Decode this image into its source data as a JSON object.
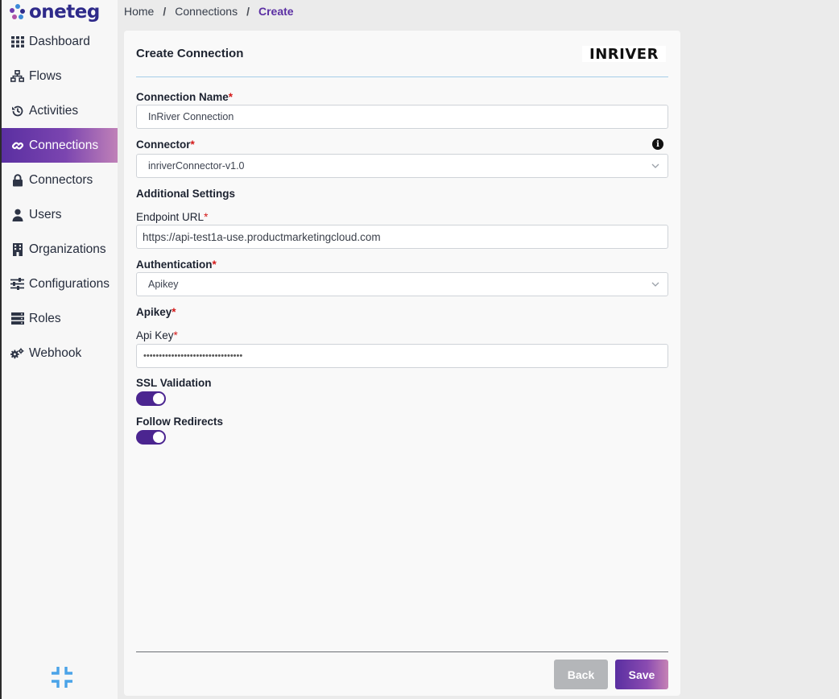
{
  "app": {
    "logo_text": "oneteg"
  },
  "breadcrumb": [
    "Home",
    "Connections",
    "Create"
  ],
  "sidebar": {
    "items": [
      {
        "label": "Dashboard",
        "icon": "grid-icon"
      },
      {
        "label": "Flows",
        "icon": "sitemap-icon"
      },
      {
        "label": "Activities",
        "icon": "history-icon"
      },
      {
        "label": "Connections",
        "icon": "link-icon",
        "active": true
      },
      {
        "label": "Connectors",
        "icon": "lock-icon"
      },
      {
        "label": "Users",
        "icon": "user-icon"
      },
      {
        "label": "Organizations",
        "icon": "building-icon"
      },
      {
        "label": "Configurations",
        "icon": "sliders-icon"
      },
      {
        "label": "Roles",
        "icon": "server-icon"
      },
      {
        "label": "Webhook",
        "icon": "gears-icon"
      }
    ]
  },
  "form": {
    "title": "Create Connection",
    "brand_logo": "INRIVER",
    "connection_name": {
      "label": "Connection Name",
      "value": "InRiver Connection"
    },
    "connector": {
      "label": "Connector",
      "value": "inriverConnector-v1.0"
    },
    "additional_settings": "Additional Settings",
    "endpoint_url": {
      "label": "Endpoint URL",
      "value": "https://api-test1a-use.productmarketingcloud.com"
    },
    "authentication": {
      "label": "Authentication",
      "value": "Apikey"
    },
    "apikey_section": "Apikey",
    "api_key": {
      "label": "Api Key",
      "value": "••••••••••••••••••••••••••••••••"
    },
    "ssl_validation": {
      "label": "SSL Validation",
      "enabled": true
    },
    "follow_redirects": {
      "label": "Follow Redirects",
      "enabled": true
    },
    "required_mark": "*",
    "back_label": "Back",
    "save_label": "Save"
  },
  "colors": {
    "accent": "#5a2fa1",
    "toggle": "#4b2590",
    "required": "#d41919"
  }
}
